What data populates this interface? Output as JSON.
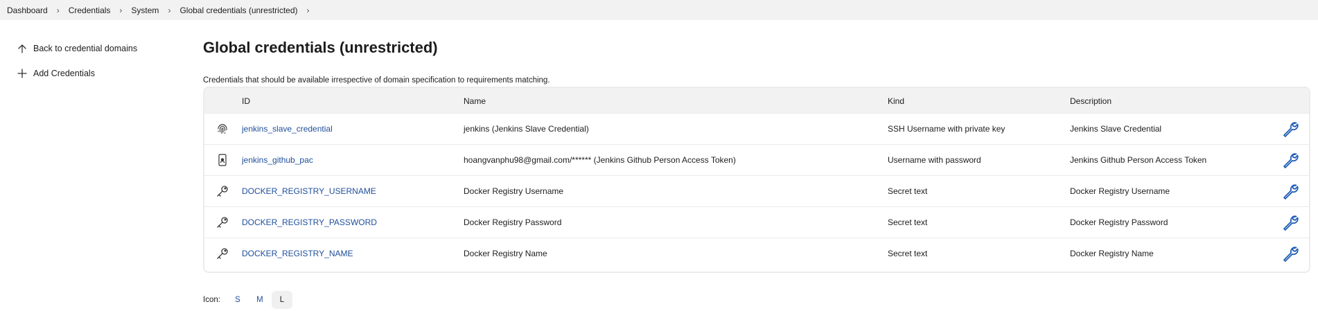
{
  "breadcrumb": [
    "Dashboard",
    "Credentials",
    "System",
    "Global credentials (unrestricted)"
  ],
  "sidebar": {
    "items": [
      {
        "label": "Back to credential domains",
        "icon": "arrow-up-icon"
      },
      {
        "label": "Add Credentials",
        "icon": "plus-icon"
      }
    ]
  },
  "page": {
    "title": "Global credentials (unrestricted)",
    "subtitle": "Credentials that should be available irrespective of domain specification to requirements matching."
  },
  "table": {
    "headers": {
      "id": "ID",
      "name": "Name",
      "kind": "Kind",
      "description": "Description"
    },
    "rows": [
      {
        "icon": "fingerprint-icon",
        "id": "jenkins_slave_credential",
        "name": "jenkins (Jenkins Slave Credential)",
        "kind": "SSH Username with private key",
        "description": "Jenkins Slave Credential"
      },
      {
        "icon": "mobile-badge-icon",
        "id": "jenkins_github_pac",
        "name": "hoangvanphu98@gmail.com/****** (Jenkins Github Person Access Token)",
        "kind": "Username with password",
        "description": "Jenkins Github Person Access Token"
      },
      {
        "icon": "key-icon",
        "id": "DOCKER_REGISTRY_USERNAME",
        "name": "Docker Registry Username",
        "kind": "Secret text",
        "description": "Docker Registry Username"
      },
      {
        "icon": "key-icon",
        "id": "DOCKER_REGISTRY_PASSWORD",
        "name": "Docker Registry Password",
        "kind": "Secret text",
        "description": "Docker Registry Password"
      },
      {
        "icon": "key-icon",
        "id": "DOCKER_REGISTRY_NAME",
        "name": "Docker Registry Name",
        "kind": "Secret text",
        "description": "Docker Registry Name"
      }
    ]
  },
  "icon_size": {
    "label": "Icon:",
    "options": [
      "S",
      "M",
      "L"
    ],
    "selected": "L"
  },
  "colors": {
    "link": "#1e4e9b",
    "wrench": "#1e5db5",
    "header_bg": "#f2f2f2"
  }
}
